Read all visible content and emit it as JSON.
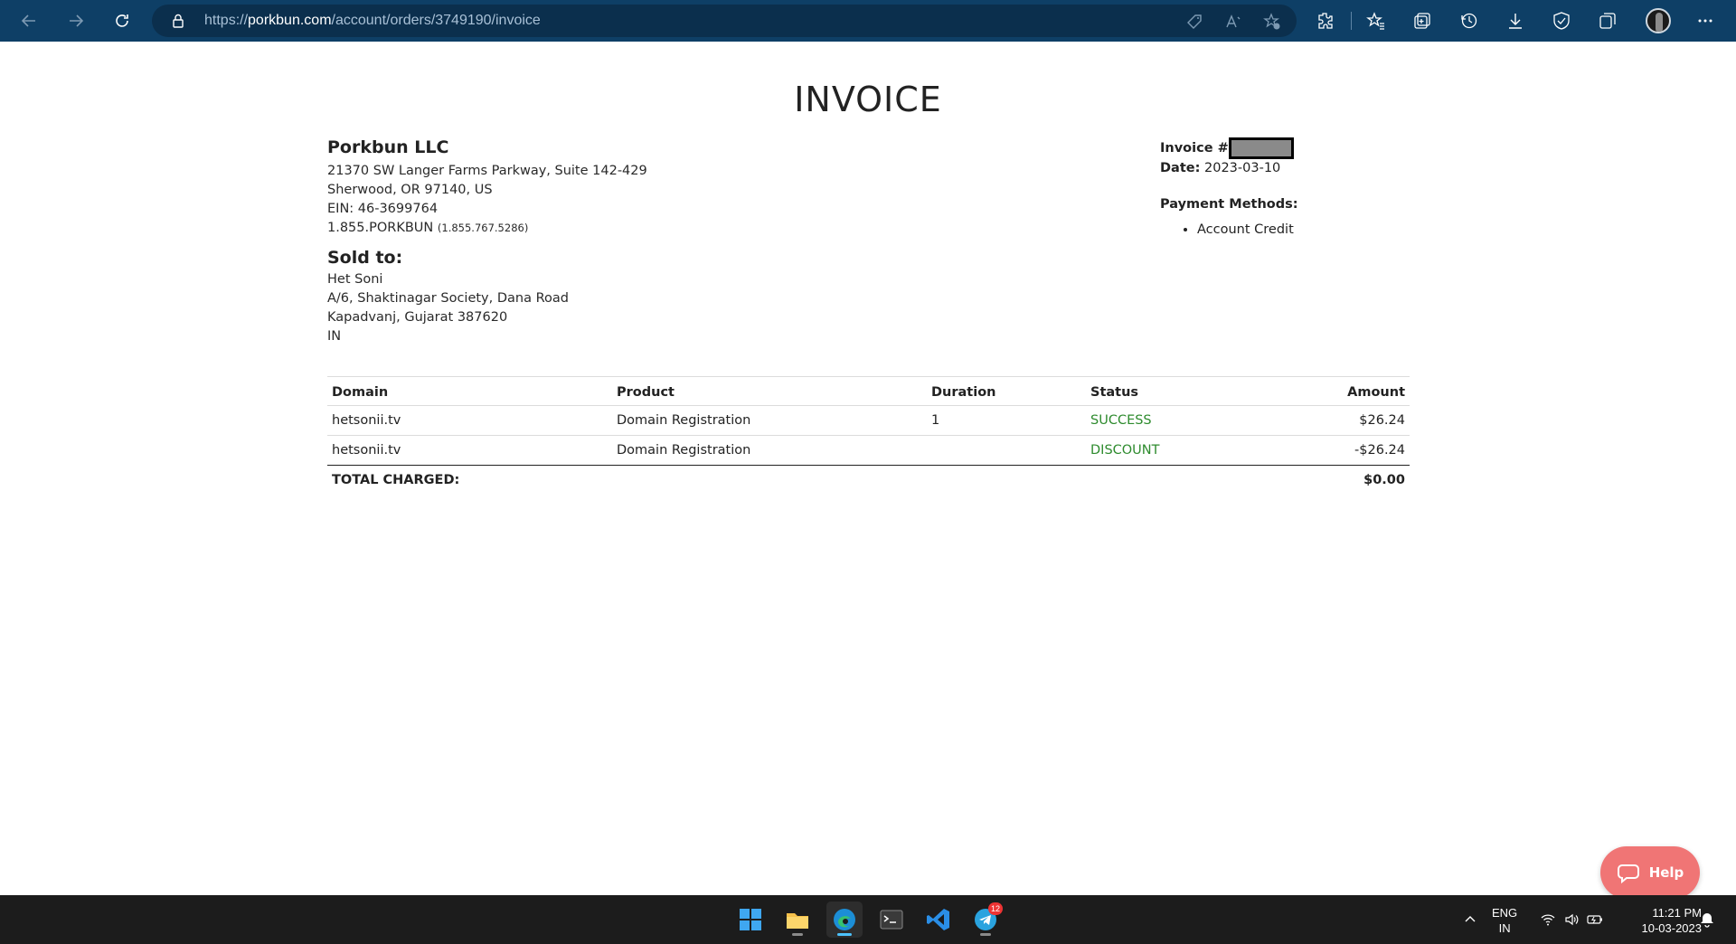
{
  "browser": {
    "url_prefix": "https://",
    "url_domain": "porkbun.com",
    "url_path": "/account/orders/3749190/invoice"
  },
  "invoice": {
    "title": "INVOICE",
    "company": {
      "name": "Porkbun LLC",
      "address1": "21370 SW Langer Farms Parkway, Suite 142-429",
      "address2": "Sherwood, OR 97140, US",
      "ein": "EIN: 46-3699764",
      "phone": "1.855.PORKBUN",
      "phone_numeric": "(1.855.767.5286)"
    },
    "sold_to": {
      "heading": "Sold to:",
      "name": "Het Soni",
      "address1": "A/6, Shaktinagar Society, Dana Road",
      "address2": "Kapadvanj, Gujarat 387620",
      "country": "IN"
    },
    "meta": {
      "invoice_label": "Invoice #",
      "date_label": "Date:",
      "date_value": "2023-03-10",
      "payment_methods_label": "Payment Methods:",
      "payment_methods": [
        "Account Credit"
      ]
    },
    "table": {
      "headers": [
        "Domain",
        "Product",
        "Duration",
        "Status",
        "Amount"
      ],
      "rows": [
        {
          "domain": "hetsonii.tv",
          "product": "Domain Registration",
          "duration": "1",
          "status": "SUCCESS",
          "amount": "$26.24"
        },
        {
          "domain": "hetsonii.tv",
          "product": "Domain Registration",
          "duration": "",
          "status": "DISCOUNT",
          "amount": "-$26.24"
        }
      ],
      "total_label": "TOTAL CHARGED:",
      "total_value": "$0.00"
    },
    "help_label": "Help",
    "status_color": "#2e8b2e",
    "help_color": "#f07575"
  },
  "taskbar": {
    "lang_line1": "ENG",
    "lang_line2": "IN",
    "time": "11:21 PM",
    "date": "10-03-2023",
    "telegram_badge": "12"
  }
}
